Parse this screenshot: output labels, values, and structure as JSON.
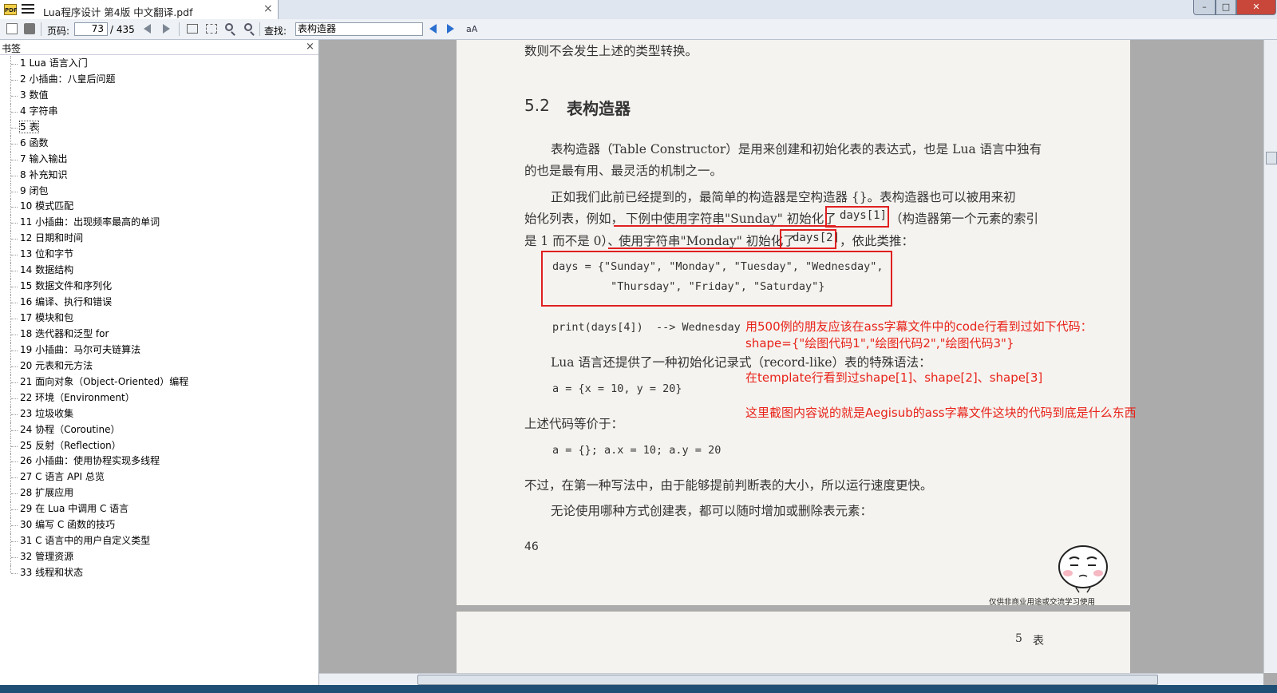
{
  "window": {
    "tab_title": "Lua程序设计 第4版 中文翻译.pdf",
    "app_icon_text": "PDF",
    "tab_close": "×",
    "min_btn": "–",
    "max_btn": "□",
    "close_btn": "✕"
  },
  "toolbar": {
    "page_label": "页码:",
    "page_value": "73",
    "page_total": "/ 435",
    "search_label": "查找:",
    "search_value": "表构造器",
    "match_case_label": "aA"
  },
  "sidebar": {
    "title": "书签",
    "close": "×",
    "items": [
      "1 Lua 语言入门",
      "2 小插曲：八皇后问题",
      "3 数值",
      "4 字符串",
      "5 表",
      "6 函数",
      "7 输入输出",
      "8 补充知识",
      "9 闭包",
      "10 模式匹配",
      "11 小插曲：出现频率最高的单词",
      "12 日期和时间",
      "13 位和字节",
      "14 数据结构",
      "15 数据文件和序列化",
      "16 编译、执行和错误",
      "17 模块和包",
      "18 迭代器和泛型 for",
      "19 小插曲：马尔可夫链算法",
      "20 元表和元方法",
      "21 面向对象（Object-Oriented）编程",
      "22 环境（Environment）",
      "23 垃圾收集",
      "24 协程（Coroutine）",
      "25 反射（Reflection）",
      "26 小插曲：使用协程实现多线程",
      "27 C 语言 API 总览",
      "28 扩展应用",
      "29 在 Lua 中调用 C 语言",
      "30 编写 C 函数的技巧",
      "31 C 语言中的用户自定义类型",
      "32 管理资源",
      "33 线程和状态"
    ],
    "selected": "5 表"
  },
  "page": {
    "line_top": "数则不会发生上述的类型转换。",
    "heading_num": "5.2",
    "heading_text": "表构造器",
    "p1_l1": "表构造器（Table Constructor）是用来创建和初始化表的表达式，也是 Lua 语言中独有",
    "p1_l2": "的也是最有用、最灵活的机制之一。",
    "p2_l1": "正如我们此前已经提到的，最简单的构造器是空构造器 {}。表构造器也可以被用来初",
    "p2_l2_a": "始化列表，例如，",
    "p2_l2_b": "下例中使用字符串\"Sunday\" 初始化了",
    "p2_l2_c": "days[1]",
    "p2_l2_d": "（构造器第一个元素的索引",
    "p2_l3_a": "是 1 而不是 0）、",
    "p2_l3_b": "使用字符串\"Monday\" 初始化了",
    "p2_l3_c": "days[2]",
    "p2_l3_d": "，依此类推：",
    "code1_l1": "days = {\"Sunday\", \"Monday\", \"Tuesday\", \"Wednesday\",",
    "code1_l2": "         \"Thursday\", \"Friday\", \"Saturday\"}",
    "code2": "print(days[4])  --> Wednesday",
    "p3": "Lua 语言还提供了一种初始化记录式（record-like）表的特殊语法：",
    "code3": "a = {x = 10, y = 20}",
    "p4": "上述代码等价于：",
    "code4": "a = {}; a.x = 10; a.y = 20",
    "p5": "不过，在第一种写法中，由于能够提前判断表的大小，所以运行速度更快。",
    "p6": "无论使用哪种方式创建表，都可以随时增加或删除表元素：",
    "page_number": "46",
    "watermark": "仅供非商业用途或交流学习使用",
    "next_page_header_num": "5",
    "next_page_header_text": "表"
  },
  "annotations": {
    "note1": "用500例的朋友应该在ass字幕文件中的code行看到过如下代码：",
    "note2": "shape={\"绘图代码1\",\"绘图代码2\",\"绘图代码3\"}",
    "note3": "在template行看到过shape[1]、shape[2]、shape[3]",
    "note4": "这里截图内容说的就是Aegisub的ass字幕文件这块的代码到底是什么东西",
    "color": "#e8231a"
  }
}
